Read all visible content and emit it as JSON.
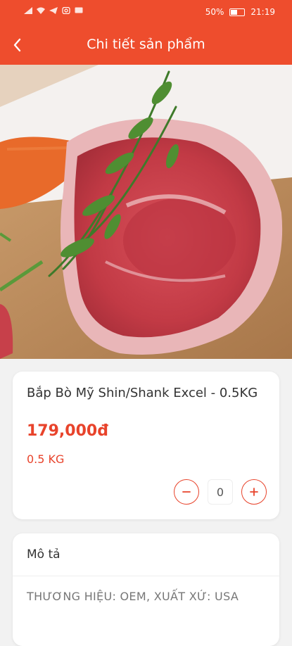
{
  "status_bar": {
    "battery": "50%",
    "time": "21:19",
    "battery_level": 0.5
  },
  "header": {
    "title": "Chi tiết sản phẩm",
    "back_icon": "chevron-left-icon"
  },
  "product": {
    "name": "Bắp Bò Mỹ Shin/Shank Excel - 0.5KG",
    "price": "179,000đ",
    "unit": "0.5 KG",
    "quantity": "0"
  },
  "description": {
    "heading": "Mô tả",
    "text": "THƯƠNG HIỆU: OEM, XUẤT XỨ: USA"
  },
  "colors": {
    "accent": "#ee4d2d",
    "price": "#e8432b"
  }
}
